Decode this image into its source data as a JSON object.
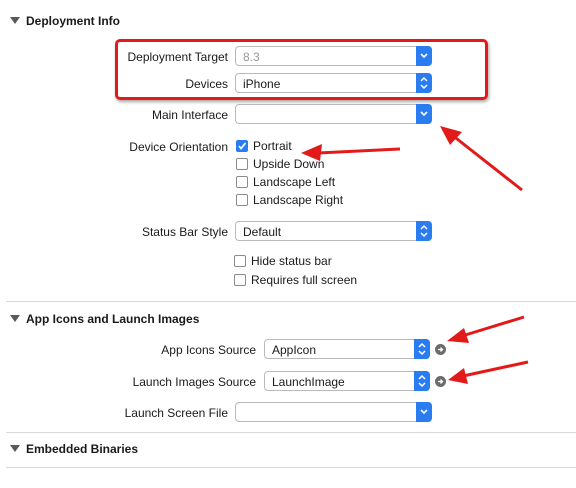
{
  "sections": {
    "deployment": {
      "title": "Deployment Info"
    },
    "app_icons": {
      "title": "App Icons and Launch Images"
    },
    "embedded": {
      "title": "Embedded Binaries"
    }
  },
  "deployment": {
    "target": {
      "label": "Deployment Target",
      "value": "8.3"
    },
    "devices": {
      "label": "Devices",
      "value": "iPhone"
    },
    "main_interface": {
      "label": "Main Interface",
      "value": ""
    },
    "orientation": {
      "label": "Device Orientation",
      "options": [
        {
          "label": "Portrait",
          "checked": true
        },
        {
          "label": "Upside Down",
          "checked": false
        },
        {
          "label": "Landscape Left",
          "checked": false
        },
        {
          "label": "Landscape Right",
          "checked": false
        }
      ]
    },
    "status_bar": {
      "label": "Status Bar Style",
      "value": "Default"
    },
    "hide_status_bar": {
      "label": "Hide status bar",
      "checked": false
    },
    "requires_full_screen": {
      "label": "Requires full screen",
      "checked": false
    }
  },
  "app_icons": {
    "icons_source": {
      "label": "App Icons Source",
      "value": "AppIcon"
    },
    "launch_images_source": {
      "label": "Launch Images Source",
      "value": "LaunchImage"
    },
    "launch_screen_file": {
      "label": "Launch Screen File",
      "value": ""
    }
  },
  "colors": {
    "accent": "#2a7df1",
    "annotation": "#e31a1a"
  }
}
